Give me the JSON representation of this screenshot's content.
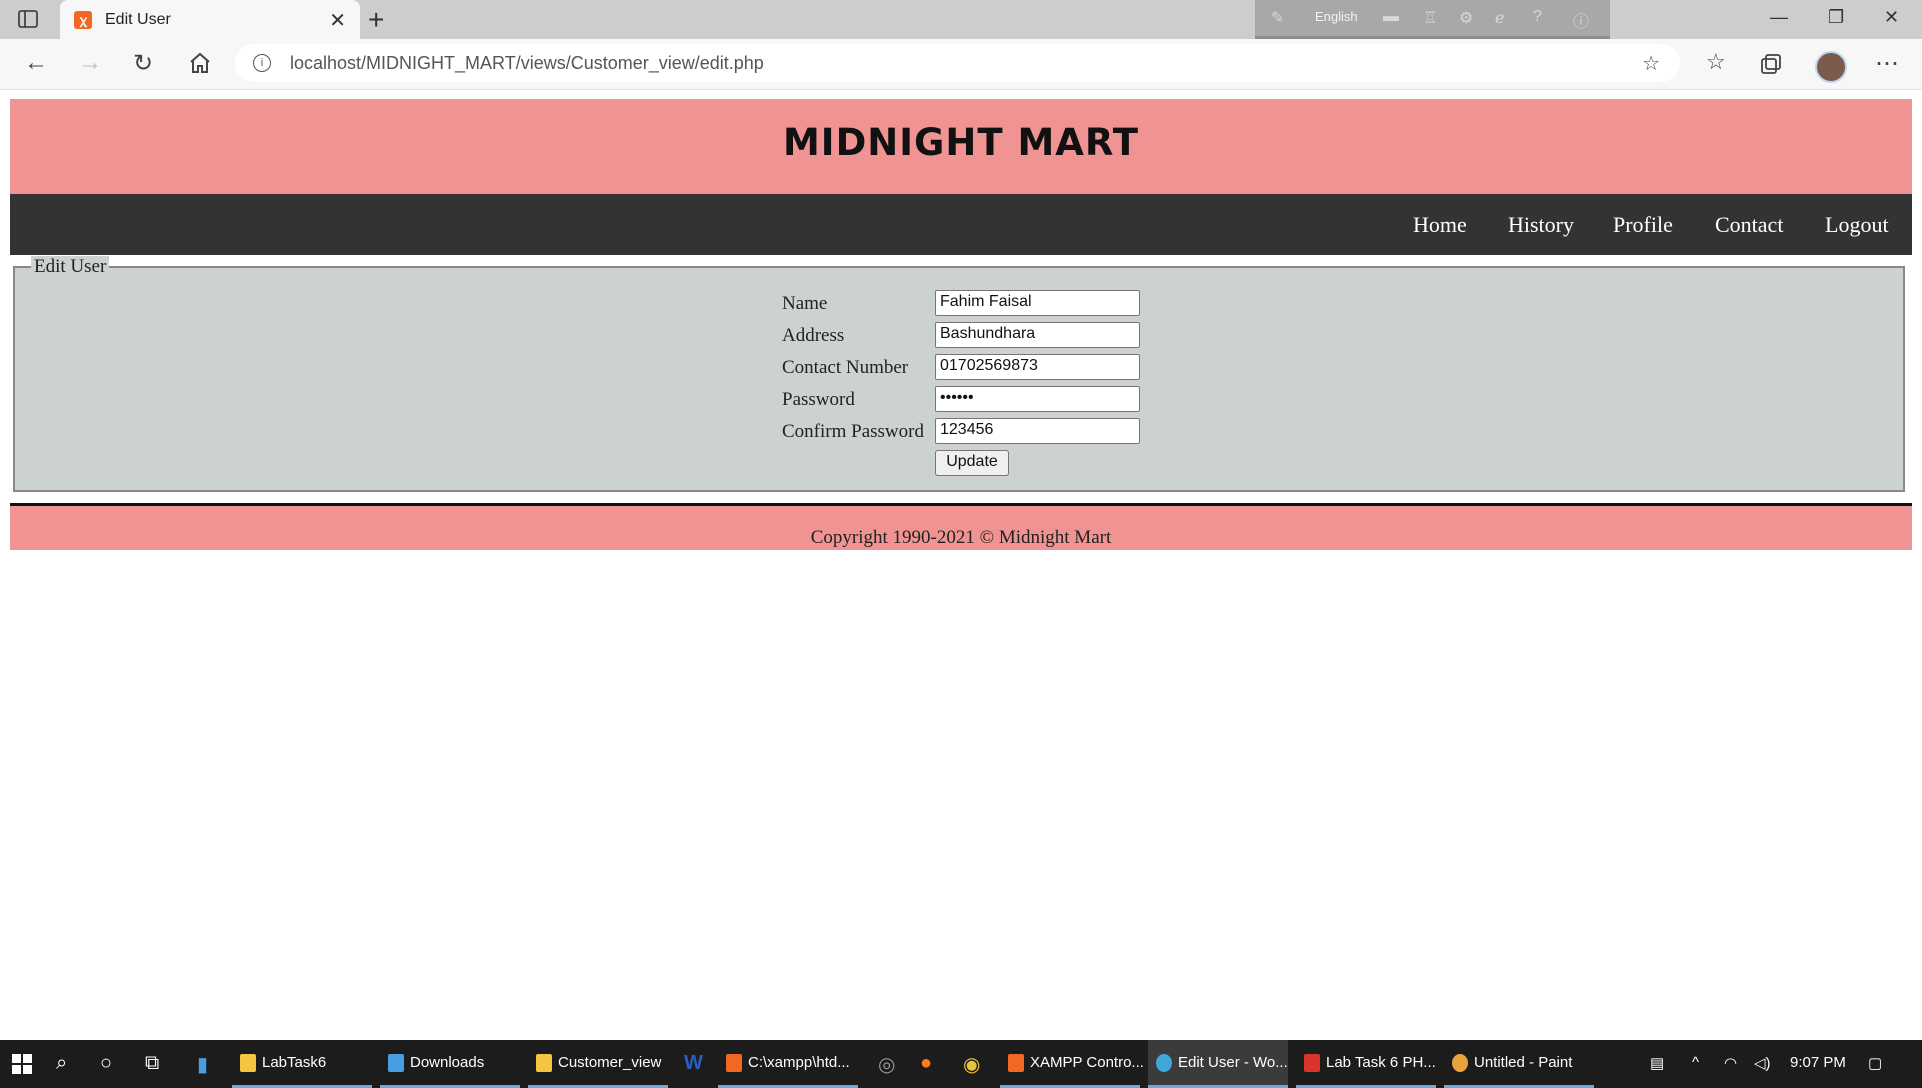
{
  "browser": {
    "tab_title": "Edit User",
    "tab_favicon": "ꭓ",
    "new_tab": "+",
    "close_tab": "✕",
    "url": "localhost/MIDNIGHT_MART/views/Customer_view/edit.php",
    "ime_language": "English",
    "icons": [
      "sidebar-icon",
      "back-icon",
      "forward-icon",
      "refresh-icon",
      "home-icon",
      "info-icon",
      "add-favorite-icon",
      "favorites-icon",
      "collections-icon",
      "avatar",
      "more-icon"
    ]
  },
  "site": {
    "title": "MIDNIGHT MART",
    "nav": [
      "Home",
      "History",
      "Profile",
      "Contact",
      "Logout"
    ],
    "footer": "Copyright 1990-2021 © Midnight Mart"
  },
  "form": {
    "legend": "Edit User",
    "fields": [
      {
        "label": "Name",
        "value": "Fahim Faisal"
      },
      {
        "label": "Address",
        "value": "Bashundhara"
      },
      {
        "label": "Contact Number",
        "value": "01702569873"
      },
      {
        "label": "Password",
        "value": "••••••"
      },
      {
        "label": "Confirm Password",
        "value": "123456"
      }
    ],
    "submit": "Update"
  },
  "taskbar": {
    "items": [
      {
        "label": "LabTask6",
        "color": "#f5c542"
      },
      {
        "label": "Downloads",
        "color": "#4a9de0"
      },
      {
        "label": "Customer_view",
        "color": "#f5c542"
      },
      {
        "label": "C:\\xampp\\htd...",
        "color": "#f16822"
      },
      {
        "label": "XAMPP Contro...",
        "color": "#f16822"
      },
      {
        "label": "Edit User - Wo...",
        "color": "#3fa8d8"
      },
      {
        "label": "Lab Task 6 PH...",
        "color": "#d9342b"
      },
      {
        "label": "Untitled - Paint",
        "color": "#e8a33d"
      }
    ],
    "time": "9:07 PM"
  }
}
